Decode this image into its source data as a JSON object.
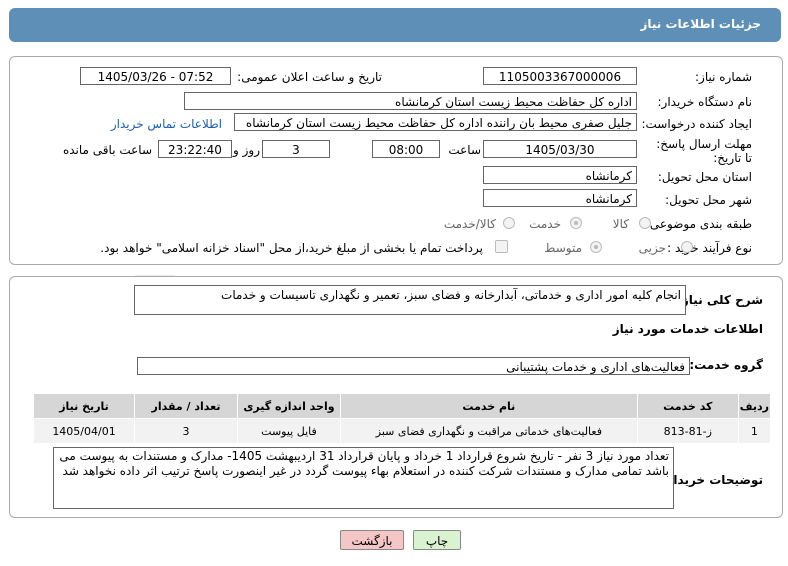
{
  "header": {
    "title": "جزئیات اطلاعات نیاز"
  },
  "fields": {
    "need_number_label": "شماره نیاز:",
    "need_number": "1105003367000006",
    "announce_label": "تاریخ و ساعت اعلان عمومی:",
    "announce_value": "1405/03/26 - 07:52",
    "buyer_org_label": "نام دستگاه خریدار:",
    "buyer_org": "اداره کل حفاظت محیط زیست استان کرمانشاه",
    "creator_label": "ایجاد کننده درخواست:",
    "creator": "جلیل  صفری محیط بان راننده اداره کل حفاظت محیط زیست استان کرمانشاه",
    "contact_link": "اطلاعات تماس خریدار",
    "deadline_label": "مهلت ارسال پاسخ: تا تاریخ:",
    "deadline_date": "1405/03/30",
    "time_label": "ساعت",
    "deadline_time": "08:00",
    "days_value": "3",
    "days_label": "روز و",
    "remaining_value": "23:22:40",
    "remaining_label": "ساعت باقی مانده",
    "province_label": "استان محل تحویل:",
    "province": "کرمانشاه",
    "city_label": "شهر محل تحویل:",
    "city": "کرمانشاه",
    "category_label": "طبقه بندی موضوعی:",
    "category_options": [
      "کالا",
      "خدمت",
      "کالا/خدمت"
    ],
    "process_label": "نوع فرآیند خرید :",
    "process_options": [
      "جزیی",
      "متوسط"
    ],
    "payment_note": "پرداخت تمام یا بخشی از مبلغ خرید،از محل \"اسناد خزانه اسلامی\" خواهد بود."
  },
  "summary": {
    "label": "شرح کلی نیاز:",
    "text": "انجام کلیه امور اداری و خدماتی، آبدارخانه و فضای سبز، تعمیر و نگهداری تاسیسات و خدمات"
  },
  "services": {
    "section_title": "اطلاعات خدمات مورد نیاز",
    "group_label": "گروه خدمت:",
    "group_value": "فعالیت‌های اداری و خدمات پشتیبانی",
    "columns": [
      "ردیف",
      "کد خدمت",
      "نام خدمت",
      "واحد اندازه گیری",
      "تعداد / مقدار",
      "تاریخ نیاز"
    ],
    "rows": [
      [
        "1",
        "ز-81-813",
        "فعالیت‌های خدماتی مراقبت و نگهداری فضای سبز",
        "فایل پیوست",
        "3",
        "1405/04/01"
      ]
    ]
  },
  "buyer_notes": {
    "label": "توضیحات خریدار:",
    "text": "تعداد مورد نیاز 3 نفر - تاریخ شروع قرارداد 1 خرداد و پایان قرارداد 31 اردیبهشت 1405- مدارک و مستندات به پیوست می باشد تمامی مدارک و مستندات شرکت کننده در استعلام بهاء پیوست گردد در غیر اینصورت پاسخ ترتیب اثر داده نخواهد شد"
  },
  "buttons": {
    "print": "چاپ",
    "back": "بازگشت"
  },
  "colors": {
    "header": "#5d8fb7",
    "link": "#1a5fb4",
    "back_button": "#f4c6c6",
    "print_button": "#d9f2d0"
  }
}
